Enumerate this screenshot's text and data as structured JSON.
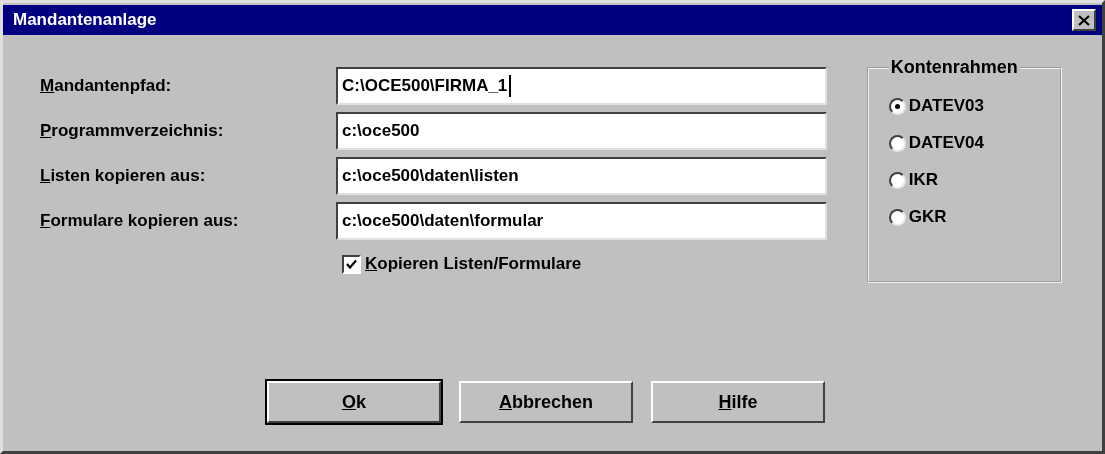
{
  "window": {
    "title": "Mandantenanlage"
  },
  "fields": [
    {
      "label": {
        "mnemonic": "M",
        "rest": "andantenpfad:"
      },
      "value": "C:\\OCE500\\FIRMA_1",
      "focused": true
    },
    {
      "label": {
        "mnemonic": "P",
        "rest": "rogrammverzeichnis:"
      },
      "value": "c:\\oce500",
      "focused": false
    },
    {
      "label": {
        "mnemonic": "L",
        "rest": "isten kopieren aus:"
      },
      "value": "c:\\oce500\\daten\\listen",
      "focused": false
    },
    {
      "label": {
        "mnemonic": "F",
        "rest": "ormulare kopieren aus:"
      },
      "value": "c:\\oce500\\daten\\formular",
      "focused": false
    }
  ],
  "copy_checkbox": {
    "label": {
      "mnemonic": "K",
      "rest": "opieren Listen/Formulare"
    },
    "checked": true
  },
  "kontenrahmen": {
    "title": "Kontenrahmen",
    "options": [
      {
        "label": "DATEV03",
        "selected": true
      },
      {
        "label": "DATEV04",
        "selected": false
      },
      {
        "label": "IKR",
        "selected": false
      },
      {
        "label": "GKR",
        "selected": false
      }
    ]
  },
  "buttons": [
    {
      "label": {
        "mnemonic": "O",
        "rest": "k"
      },
      "default": true
    },
    {
      "label": {
        "mnemonic": "A",
        "rest": "bbrechen"
      },
      "default": false
    },
    {
      "label": {
        "mnemonic": "H",
        "rest": "ilfe"
      },
      "default": false
    }
  ]
}
